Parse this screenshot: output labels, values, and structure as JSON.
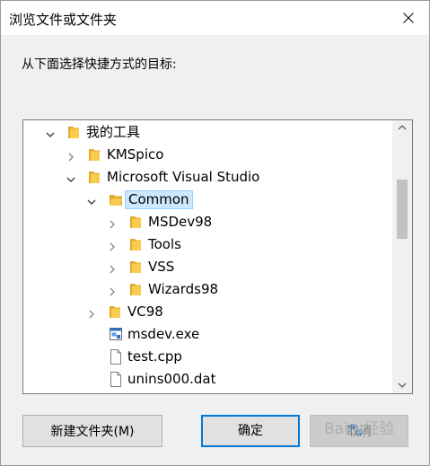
{
  "dialog": {
    "title": "浏览文件或文件夹",
    "instruction": "从下面选择快捷方式的目标:"
  },
  "tree": {
    "items": [
      {
        "label": "我的工具",
        "depth": 0,
        "expander": "expanded",
        "icon": "folder-icon"
      },
      {
        "label": "KMSpico",
        "depth": 1,
        "expander": "collapsed",
        "icon": "folder-icon"
      },
      {
        "label": "Microsoft Visual Studio",
        "depth": 1,
        "expander": "expanded",
        "icon": "folder-icon"
      },
      {
        "label": "Common",
        "depth": 2,
        "expander": "expanded",
        "icon": "folder-open-icon",
        "selected": true
      },
      {
        "label": "MSDev98",
        "depth": 3,
        "expander": "collapsed",
        "icon": "folder-icon"
      },
      {
        "label": "Tools",
        "depth": 3,
        "expander": "collapsed",
        "icon": "folder-icon"
      },
      {
        "label": "VSS",
        "depth": 3,
        "expander": "collapsed",
        "icon": "folder-icon"
      },
      {
        "label": "Wizards98",
        "depth": 3,
        "expander": "collapsed",
        "icon": "folder-icon"
      },
      {
        "label": "VC98",
        "depth": 2,
        "expander": "collapsed",
        "icon": "folder-icon"
      },
      {
        "label": "msdev.exe",
        "depth": 2,
        "expander": "none",
        "icon": "exe-icon"
      },
      {
        "label": "test.cpp",
        "depth": 2,
        "expander": "none",
        "icon": "file-icon"
      },
      {
        "label": "unins000.dat",
        "depth": 2,
        "expander": "none",
        "icon": "file-icon"
      }
    ]
  },
  "buttons": {
    "new_folder": "新建文件夹(M)",
    "ok": "确定",
    "cancel": "取消"
  },
  "watermark": "Bai@经验",
  "colors": {
    "folder": "#f8cd4f",
    "folder_dark": "#e0a92b",
    "selection_bg": "#cce8ff",
    "selection_border": "#99d1ff",
    "primary_border": "#0078d7"
  }
}
